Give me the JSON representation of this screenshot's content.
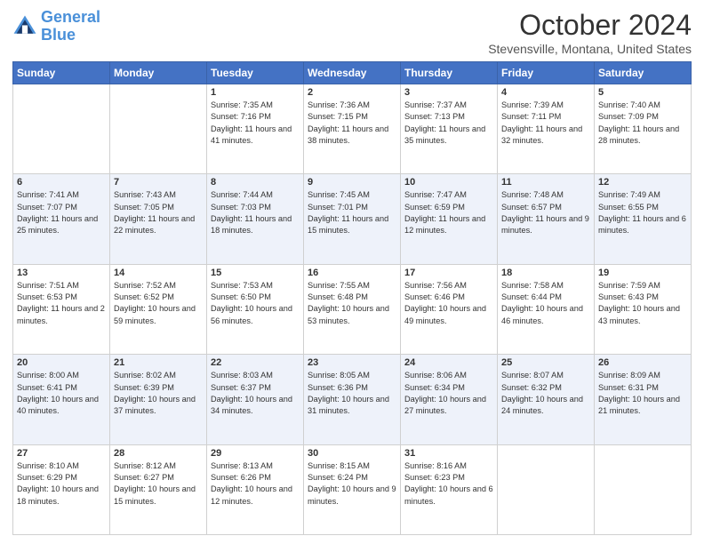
{
  "logo": {
    "line1": "General",
    "line2": "Blue"
  },
  "title": "October 2024",
  "subtitle": "Stevensville, Montana, United States",
  "days_of_week": [
    "Sunday",
    "Monday",
    "Tuesday",
    "Wednesday",
    "Thursday",
    "Friday",
    "Saturday"
  ],
  "weeks": [
    [
      {
        "day": "",
        "sunrise": "",
        "sunset": "",
        "daylight": ""
      },
      {
        "day": "",
        "sunrise": "",
        "sunset": "",
        "daylight": ""
      },
      {
        "day": "1",
        "sunrise": "Sunrise: 7:35 AM",
        "sunset": "Sunset: 7:16 PM",
        "daylight": "Daylight: 11 hours and 41 minutes."
      },
      {
        "day": "2",
        "sunrise": "Sunrise: 7:36 AM",
        "sunset": "Sunset: 7:15 PM",
        "daylight": "Daylight: 11 hours and 38 minutes."
      },
      {
        "day": "3",
        "sunrise": "Sunrise: 7:37 AM",
        "sunset": "Sunset: 7:13 PM",
        "daylight": "Daylight: 11 hours and 35 minutes."
      },
      {
        "day": "4",
        "sunrise": "Sunrise: 7:39 AM",
        "sunset": "Sunset: 7:11 PM",
        "daylight": "Daylight: 11 hours and 32 minutes."
      },
      {
        "day": "5",
        "sunrise": "Sunrise: 7:40 AM",
        "sunset": "Sunset: 7:09 PM",
        "daylight": "Daylight: 11 hours and 28 minutes."
      }
    ],
    [
      {
        "day": "6",
        "sunrise": "Sunrise: 7:41 AM",
        "sunset": "Sunset: 7:07 PM",
        "daylight": "Daylight: 11 hours and 25 minutes."
      },
      {
        "day": "7",
        "sunrise": "Sunrise: 7:43 AM",
        "sunset": "Sunset: 7:05 PM",
        "daylight": "Daylight: 11 hours and 22 minutes."
      },
      {
        "day": "8",
        "sunrise": "Sunrise: 7:44 AM",
        "sunset": "Sunset: 7:03 PM",
        "daylight": "Daylight: 11 hours and 18 minutes."
      },
      {
        "day": "9",
        "sunrise": "Sunrise: 7:45 AM",
        "sunset": "Sunset: 7:01 PM",
        "daylight": "Daylight: 11 hours and 15 minutes."
      },
      {
        "day": "10",
        "sunrise": "Sunrise: 7:47 AM",
        "sunset": "Sunset: 6:59 PM",
        "daylight": "Daylight: 11 hours and 12 minutes."
      },
      {
        "day": "11",
        "sunrise": "Sunrise: 7:48 AM",
        "sunset": "Sunset: 6:57 PM",
        "daylight": "Daylight: 11 hours and 9 minutes."
      },
      {
        "day": "12",
        "sunrise": "Sunrise: 7:49 AM",
        "sunset": "Sunset: 6:55 PM",
        "daylight": "Daylight: 11 hours and 6 minutes."
      }
    ],
    [
      {
        "day": "13",
        "sunrise": "Sunrise: 7:51 AM",
        "sunset": "Sunset: 6:53 PM",
        "daylight": "Daylight: 11 hours and 2 minutes."
      },
      {
        "day": "14",
        "sunrise": "Sunrise: 7:52 AM",
        "sunset": "Sunset: 6:52 PM",
        "daylight": "Daylight: 10 hours and 59 minutes."
      },
      {
        "day": "15",
        "sunrise": "Sunrise: 7:53 AM",
        "sunset": "Sunset: 6:50 PM",
        "daylight": "Daylight: 10 hours and 56 minutes."
      },
      {
        "day": "16",
        "sunrise": "Sunrise: 7:55 AM",
        "sunset": "Sunset: 6:48 PM",
        "daylight": "Daylight: 10 hours and 53 minutes."
      },
      {
        "day": "17",
        "sunrise": "Sunrise: 7:56 AM",
        "sunset": "Sunset: 6:46 PM",
        "daylight": "Daylight: 10 hours and 49 minutes."
      },
      {
        "day": "18",
        "sunrise": "Sunrise: 7:58 AM",
        "sunset": "Sunset: 6:44 PM",
        "daylight": "Daylight: 10 hours and 46 minutes."
      },
      {
        "day": "19",
        "sunrise": "Sunrise: 7:59 AM",
        "sunset": "Sunset: 6:43 PM",
        "daylight": "Daylight: 10 hours and 43 minutes."
      }
    ],
    [
      {
        "day": "20",
        "sunrise": "Sunrise: 8:00 AM",
        "sunset": "Sunset: 6:41 PM",
        "daylight": "Daylight: 10 hours and 40 minutes."
      },
      {
        "day": "21",
        "sunrise": "Sunrise: 8:02 AM",
        "sunset": "Sunset: 6:39 PM",
        "daylight": "Daylight: 10 hours and 37 minutes."
      },
      {
        "day": "22",
        "sunrise": "Sunrise: 8:03 AM",
        "sunset": "Sunset: 6:37 PM",
        "daylight": "Daylight: 10 hours and 34 minutes."
      },
      {
        "day": "23",
        "sunrise": "Sunrise: 8:05 AM",
        "sunset": "Sunset: 6:36 PM",
        "daylight": "Daylight: 10 hours and 31 minutes."
      },
      {
        "day": "24",
        "sunrise": "Sunrise: 8:06 AM",
        "sunset": "Sunset: 6:34 PM",
        "daylight": "Daylight: 10 hours and 27 minutes."
      },
      {
        "day": "25",
        "sunrise": "Sunrise: 8:07 AM",
        "sunset": "Sunset: 6:32 PM",
        "daylight": "Daylight: 10 hours and 24 minutes."
      },
      {
        "day": "26",
        "sunrise": "Sunrise: 8:09 AM",
        "sunset": "Sunset: 6:31 PM",
        "daylight": "Daylight: 10 hours and 21 minutes."
      }
    ],
    [
      {
        "day": "27",
        "sunrise": "Sunrise: 8:10 AM",
        "sunset": "Sunset: 6:29 PM",
        "daylight": "Daylight: 10 hours and 18 minutes."
      },
      {
        "day": "28",
        "sunrise": "Sunrise: 8:12 AM",
        "sunset": "Sunset: 6:27 PM",
        "daylight": "Daylight: 10 hours and 15 minutes."
      },
      {
        "day": "29",
        "sunrise": "Sunrise: 8:13 AM",
        "sunset": "Sunset: 6:26 PM",
        "daylight": "Daylight: 10 hours and 12 minutes."
      },
      {
        "day": "30",
        "sunrise": "Sunrise: 8:15 AM",
        "sunset": "Sunset: 6:24 PM",
        "daylight": "Daylight: 10 hours and 9 minutes."
      },
      {
        "day": "31",
        "sunrise": "Sunrise: 8:16 AM",
        "sunset": "Sunset: 6:23 PM",
        "daylight": "Daylight: 10 hours and 6 minutes."
      },
      {
        "day": "",
        "sunrise": "",
        "sunset": "",
        "daylight": ""
      },
      {
        "day": "",
        "sunrise": "",
        "sunset": "",
        "daylight": ""
      }
    ]
  ]
}
